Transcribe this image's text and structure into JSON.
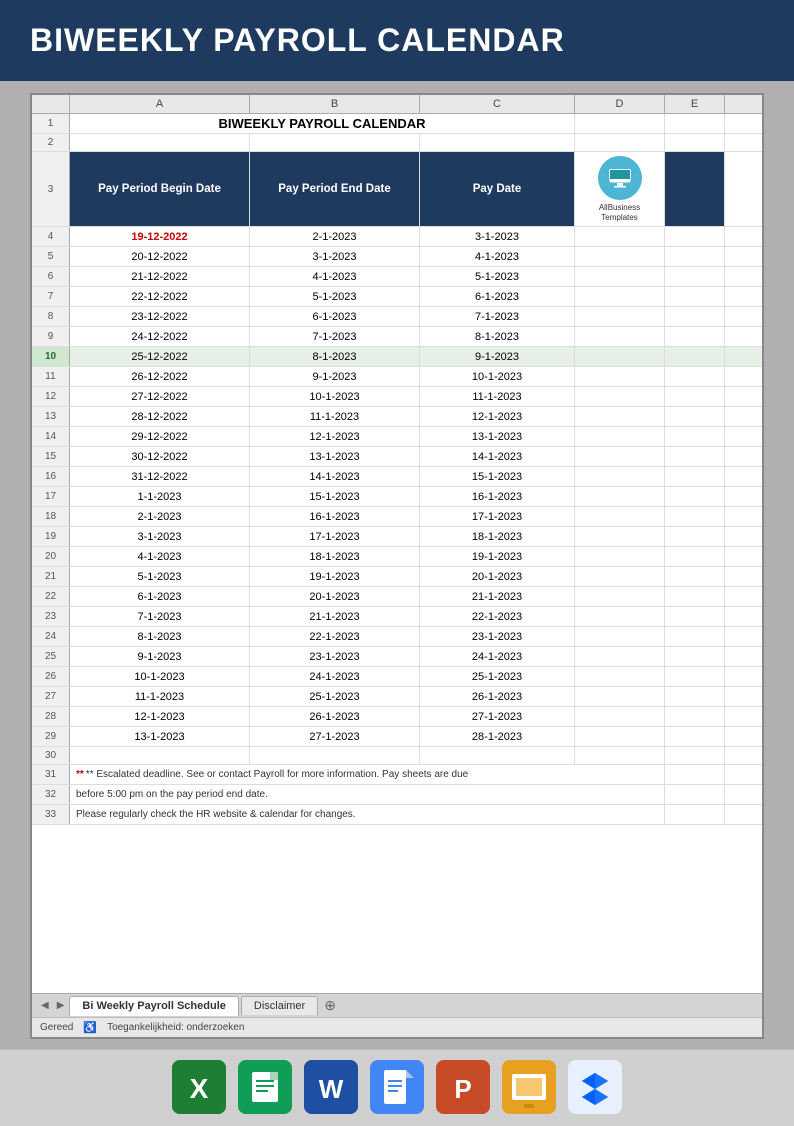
{
  "header": {
    "title": "BIWEEKLY PAYROLL CALENDAR"
  },
  "spreadsheet": {
    "title": "BIWEEKLY PAYROLL CALENDAR",
    "columns": {
      "a_label": "A",
      "b_label": "B",
      "c_label": "C",
      "d_label": "D",
      "e_label": "E"
    },
    "table_headers": {
      "col1": "Pay Period Begin Date",
      "col2": "Pay Period End Date",
      "col3": "Pay Date"
    },
    "rows": [
      {
        "num": "4",
        "a": "19-12-2022",
        "b": "2-1-2023",
        "c": "3-1-2023",
        "highlight_a": true
      },
      {
        "num": "5",
        "a": "20-12-2022",
        "b": "3-1-2023",
        "c": "4-1-2023"
      },
      {
        "num": "6",
        "a": "21-12-2022",
        "b": "4-1-2023",
        "c": "5-1-2023"
      },
      {
        "num": "7",
        "a": "22-12-2022",
        "b": "5-1-2023",
        "c": "6-1-2023"
      },
      {
        "num": "8",
        "a": "23-12-2022",
        "b": "6-1-2023",
        "c": "7-1-2023"
      },
      {
        "num": "9",
        "a": "24-12-2022",
        "b": "7-1-2023",
        "c": "8-1-2023"
      },
      {
        "num": "10",
        "a": "25-12-2022",
        "b": "8-1-2023",
        "c": "9-1-2023",
        "highlight_row": true
      },
      {
        "num": "11",
        "a": "26-12-2022",
        "b": "9-1-2023",
        "c": "10-1-2023"
      },
      {
        "num": "12",
        "a": "27-12-2022",
        "b": "10-1-2023",
        "c": "11-1-2023"
      },
      {
        "num": "13",
        "a": "28-12-2022",
        "b": "11-1-2023",
        "c": "12-1-2023"
      },
      {
        "num": "14",
        "a": "29-12-2022",
        "b": "12-1-2023",
        "c": "13-1-2023"
      },
      {
        "num": "15",
        "a": "30-12-2022",
        "b": "13-1-2023",
        "c": "14-1-2023"
      },
      {
        "num": "16",
        "a": "31-12-2022",
        "b": "14-1-2023",
        "c": "15-1-2023"
      },
      {
        "num": "17",
        "a": "1-1-2023",
        "b": "15-1-2023",
        "c": "16-1-2023"
      },
      {
        "num": "18",
        "a": "2-1-2023",
        "b": "16-1-2023",
        "c": "17-1-2023"
      },
      {
        "num": "19",
        "a": "3-1-2023",
        "b": "17-1-2023",
        "c": "18-1-2023"
      },
      {
        "num": "20",
        "a": "4-1-2023",
        "b": "18-1-2023",
        "c": "19-1-2023"
      },
      {
        "num": "21",
        "a": "5-1-2023",
        "b": "19-1-2023",
        "c": "20-1-2023"
      },
      {
        "num": "22",
        "a": "6-1-2023",
        "b": "20-1-2023",
        "c": "21-1-2023"
      },
      {
        "num": "23",
        "a": "7-1-2023",
        "b": "21-1-2023",
        "c": "22-1-2023"
      },
      {
        "num": "24",
        "a": "8-1-2023",
        "b": "22-1-2023",
        "c": "23-1-2023"
      },
      {
        "num": "25",
        "a": "9-1-2023",
        "b": "23-1-2023",
        "c": "24-1-2023"
      },
      {
        "num": "26",
        "a": "10-1-2023",
        "b": "24-1-2023",
        "c": "25-1-2023"
      },
      {
        "num": "27",
        "a": "11-1-2023",
        "b": "25-1-2023",
        "c": "26-1-2023"
      },
      {
        "num": "28",
        "a": "12-1-2023",
        "b": "26-1-2023",
        "c": "27-1-2023"
      },
      {
        "num": "29",
        "a": "13-1-2023",
        "b": "27-1-2023",
        "c": "28-1-2023"
      }
    ],
    "footer_lines": [
      "** Escalated deadline. See  or contact Payroll for more information. Pay sheets are due",
      "before 5:00 pm on the pay period end date.",
      "Please regularly check the HR website & calendar for changes."
    ],
    "tabs": [
      {
        "label": "Bi Weekly Payroll Schedule",
        "active": true
      },
      {
        "label": "Disclaimer",
        "active": false
      }
    ],
    "status_bar": {
      "ready": "Gereed",
      "accessibility": "Toegankelijkheid: onderzoeken"
    },
    "logo": {
      "line1": "AllBusiness",
      "line2": "Templates"
    }
  },
  "app_icons": [
    {
      "name": "excel",
      "type": "excel"
    },
    {
      "name": "google-sheets",
      "type": "sheets"
    },
    {
      "name": "word",
      "type": "word"
    },
    {
      "name": "google-docs",
      "type": "docs"
    },
    {
      "name": "powerpoint",
      "type": "ppt"
    },
    {
      "name": "google-slides",
      "type": "slides"
    },
    {
      "name": "dropbox",
      "type": "dropbox"
    }
  ]
}
